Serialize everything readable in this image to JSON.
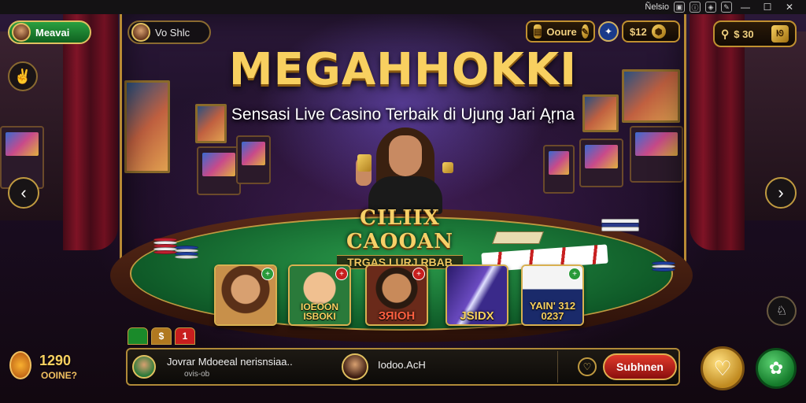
{
  "window": {
    "title": "Ñelsio",
    "controls": [
      "minimize",
      "maximize",
      "close"
    ]
  },
  "header": {
    "title": "MEGAHHOKKI",
    "subtitle": "Sensasi Live Casino Terbaik di Ujung Jari Ąŗna"
  },
  "top_left": {
    "user_label": "Meavai",
    "player_label": "Vo Shlc"
  },
  "top_right": {
    "coins_value": "Ooure",
    "chips_value": "$12",
    "balance_value": "$ 30"
  },
  "table_banner": {
    "line1": "CILIIX CAOOAN",
    "line2": "TRGAS LURJ RBAB"
  },
  "game_cards": [
    {
      "label": "",
      "badge": "+"
    },
    {
      "label": "IOEOON ISBOKI",
      "badge": "+"
    },
    {
      "label": "ЗЯІОН",
      "badge": "+"
    },
    {
      "label": "JSIDX",
      "badge": ""
    },
    {
      "label": "YAIN' 312 0237",
      "badge": "+"
    }
  ],
  "mini_tabs": [
    "",
    "$",
    "1"
  ],
  "bottom_bar": {
    "message_name": "Jovrar Mdoeeal nerisnsiaa..",
    "message_sub": "ovis-ob",
    "second_name": "Iodoo.AcH",
    "action_label": "Subhnen"
  },
  "bottom_left": {
    "amount": "1290",
    "sub": "OOINE?"
  },
  "colors": {
    "gold": "#f8d060",
    "felt": "#1a7a38",
    "accent_red": "#c81e1e",
    "accent_green": "#2a9a3a"
  },
  "icons": [
    "user-avatar",
    "coin-icon",
    "pencil-icon",
    "settings-gear-icon",
    "search-icon",
    "chevron-left-icon",
    "chevron-right-icon",
    "emoji-icon",
    "heart-icon",
    "flower-icon",
    "bell-icon"
  ]
}
